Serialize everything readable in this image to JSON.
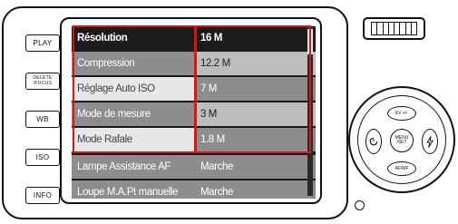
{
  "side_buttons": {
    "play": "PLAY",
    "delete_focus_line1": "DELETE",
    "delete_focus_line2": "/FOCUS",
    "wb": "WB",
    "iso": "ISO",
    "info": "INFO"
  },
  "menu": {
    "rows": [
      {
        "label": "Résolution",
        "value": "16 M"
      },
      {
        "label": "Compression",
        "value": "12.2 M"
      },
      {
        "label": "Réglage Auto ISO",
        "value": "7 M"
      },
      {
        "label": "Mode de mesure",
        "value": "3 M"
      },
      {
        "label": "Mode Rafale",
        "value": "1.8 M"
      },
      {
        "label": "Lampe Assistance  AF",
        "value": "Marche"
      },
      {
        "label": "Loupe M.A.Pt manuelle",
        "value": "Marche"
      }
    ],
    "selected_index": 0
  },
  "dial": {
    "top": "EV +/-",
    "bottom": "AF/MF",
    "left_icon": "self-timer-icon",
    "right_icon": "flash-icon",
    "center_line1": "MENU",
    "center_line2": "/SET"
  },
  "colors": {
    "highlight_red": "#d0181e",
    "row_selected_bg": "#1c1c1c",
    "row_mid_bg": "#8d8d8d",
    "row_light_bg": "#bdbdbd",
    "row_white_bg": "#e7e7e7"
  }
}
